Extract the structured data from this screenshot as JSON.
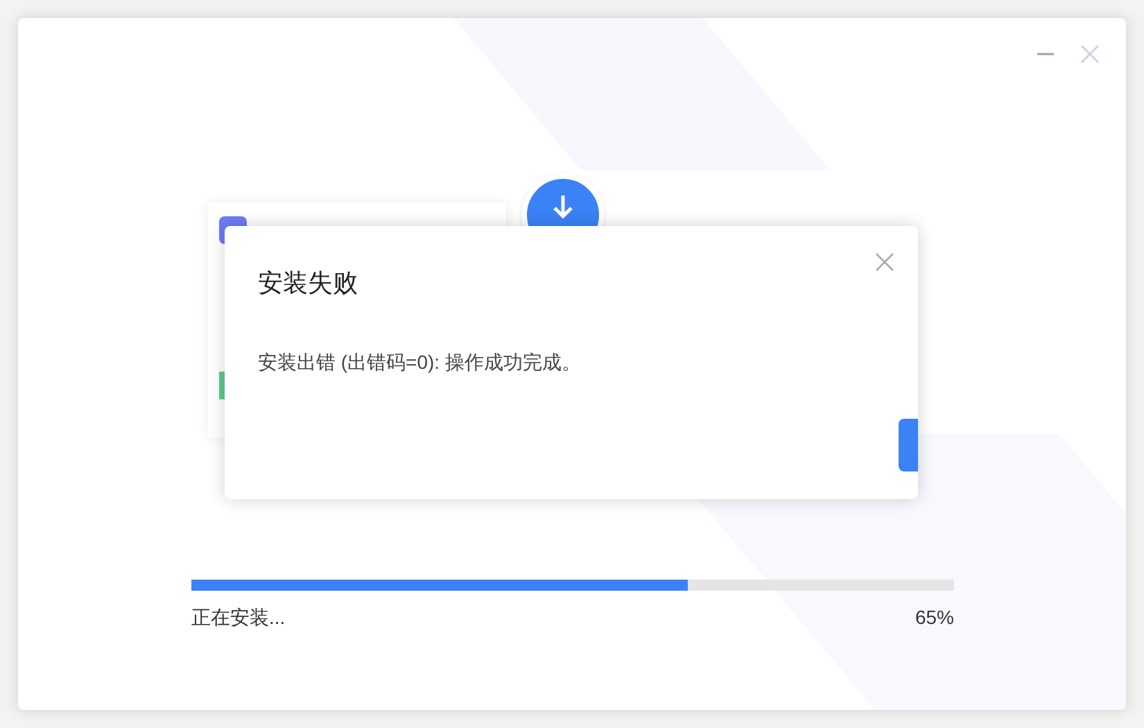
{
  "window": {
    "controls": [
      {
        "kind": "minimize"
      },
      {
        "kind": "close"
      }
    ]
  },
  "progress": {
    "level": 0.65,
    "status": "正在安装...",
    "percent": "65%"
  },
  "dialog": {
    "title": "安装失败",
    "message": "安装出错 (出错码=0): 操作成功完成。"
  }
}
